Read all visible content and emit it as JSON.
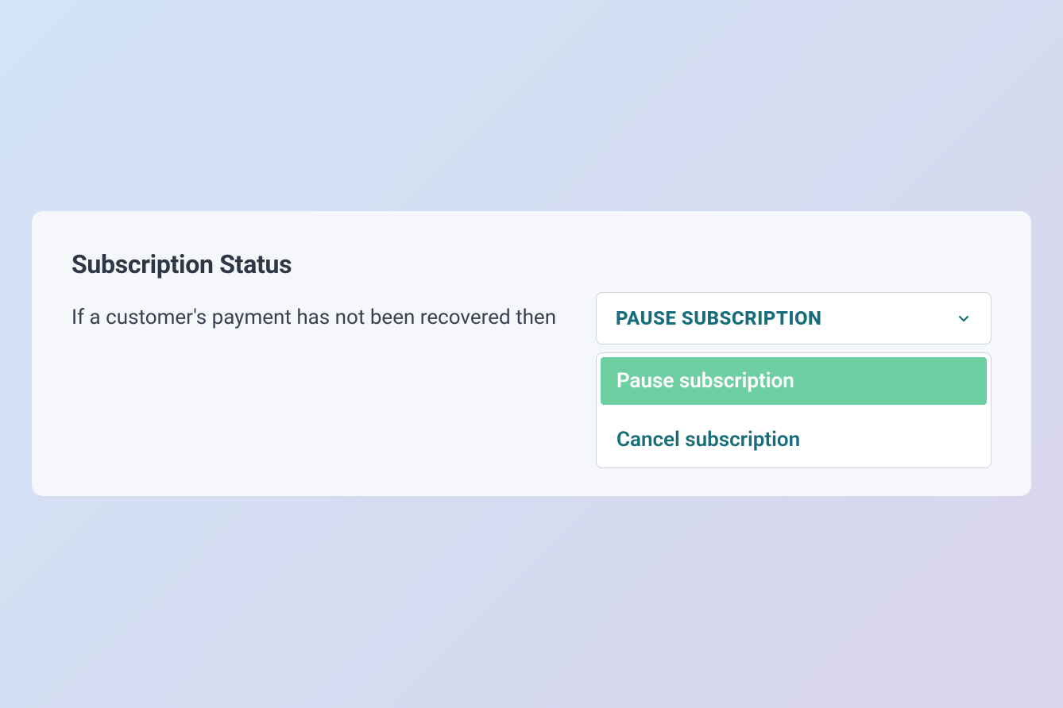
{
  "card": {
    "title": "Subscription Status",
    "description": "If a customer's payment has not been recovered then",
    "select": {
      "selected_label": "PAUSE SUBSCRIPTION",
      "options": [
        {
          "label": "Pause subscription",
          "selected": true
        },
        {
          "label": "Cancel subscription",
          "selected": false
        }
      ]
    }
  },
  "colors": {
    "accent_teal": "#186d7a",
    "highlight_green": "#6ecfa2",
    "card_bg": "#f5f7fa",
    "text_dark": "#2e3748"
  }
}
